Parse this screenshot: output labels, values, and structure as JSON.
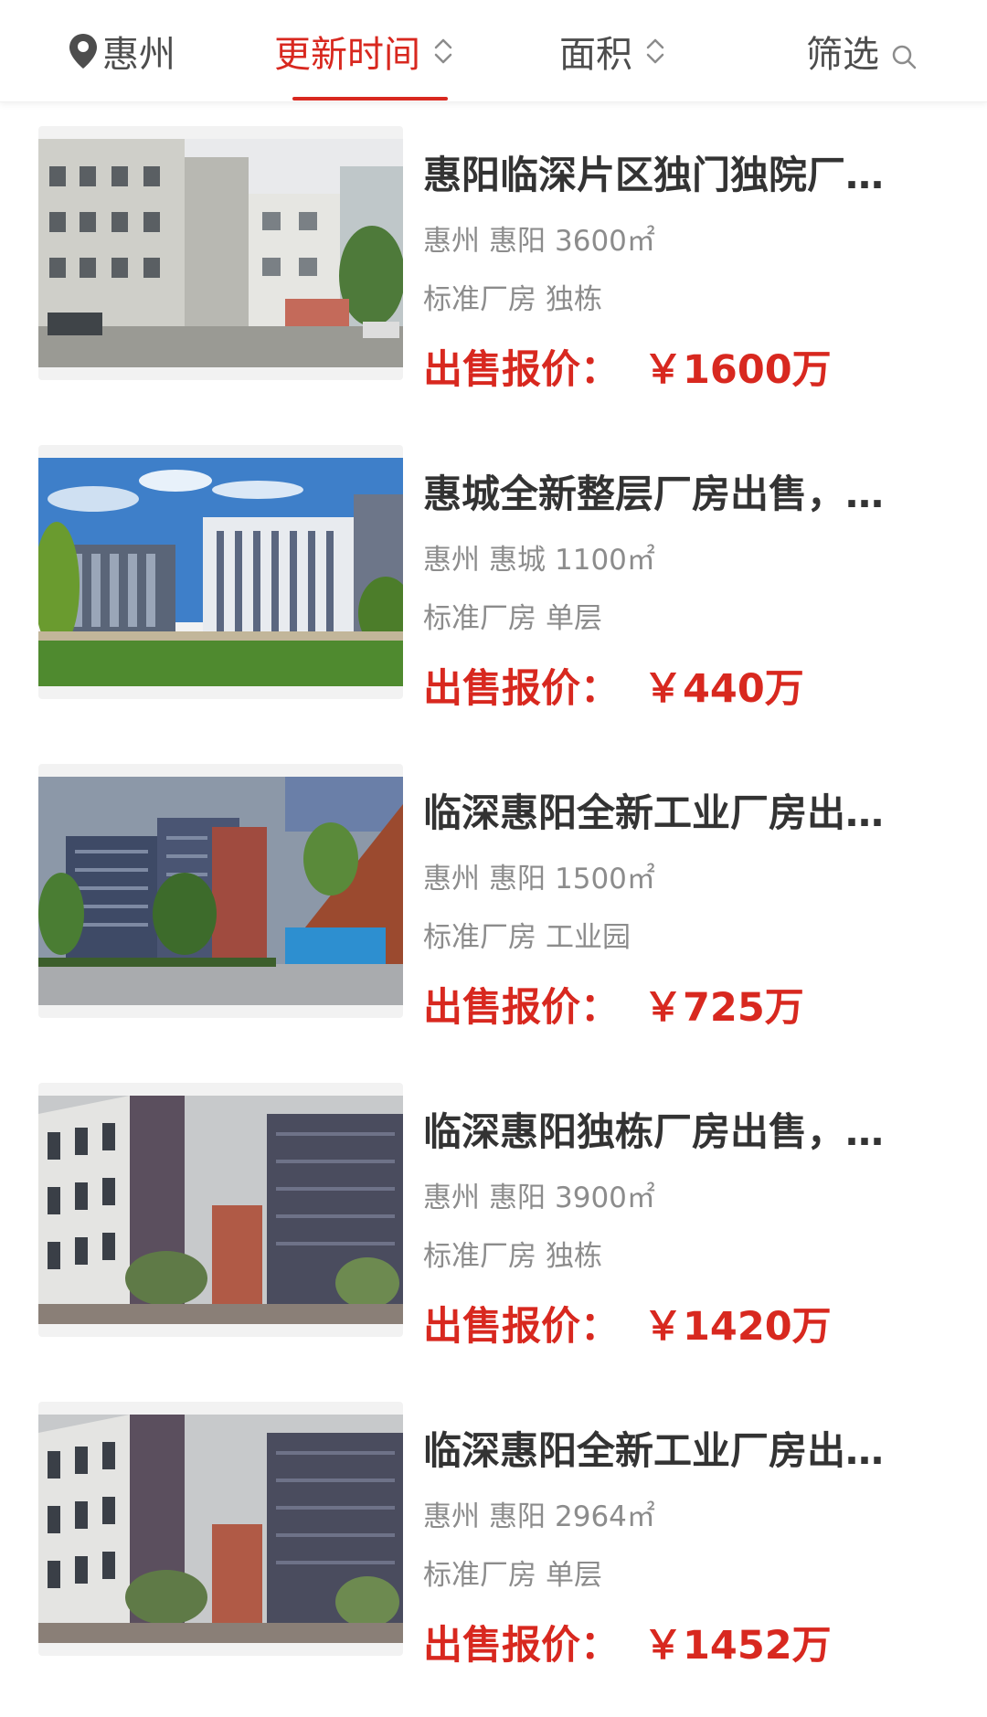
{
  "filter_bar": {
    "city_label": "惠州",
    "sort_time_label": "更新时间",
    "sort_area_label": "面积",
    "filter_label": "筛选",
    "accent_color": "#d8281f",
    "icons": {
      "city": "location-pin-icon",
      "time": "sort-chevrons-icon",
      "area": "sort-chevrons-icon",
      "filter": "search-icon"
    }
  },
  "listings": [
    {
      "title": "惠阳临深片区独门独院厂…",
      "city": "惠州",
      "district": "惠阳",
      "area": "3600㎡",
      "type": "标准厂房",
      "tag": "独栋",
      "price_label": "出售报价：",
      "price": "￥1600万"
    },
    {
      "title": "惠城全新整层厂房出售，…",
      "city": "惠州",
      "district": "惠城",
      "area": "1100㎡",
      "type": "标准厂房",
      "tag": "单层",
      "price_label": "出售报价：",
      "price": "￥440万"
    },
    {
      "title": "临深惠阳全新工业厂房出…",
      "city": "惠州",
      "district": "惠阳",
      "area": "1500㎡",
      "type": "标准厂房",
      "tag": "工业园",
      "price_label": "出售报价：",
      "price": "￥725万"
    },
    {
      "title": "临深惠阳独栋厂房出售，…",
      "city": "惠州",
      "district": "惠阳",
      "area": "3900㎡",
      "type": "标准厂房",
      "tag": "独栋",
      "price_label": "出售报价：",
      "price": "￥1420万"
    },
    {
      "title": "临深惠阳全新工业厂房出…",
      "city": "惠州",
      "district": "惠阳",
      "area": "2964㎡",
      "type": "标准厂房",
      "tag": "单层",
      "price_label": "出售报价：",
      "price": "￥1452万"
    }
  ]
}
